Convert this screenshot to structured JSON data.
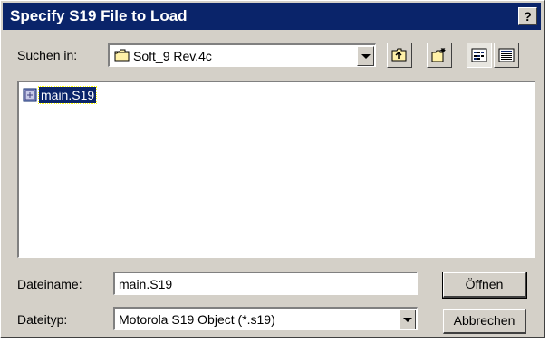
{
  "dialog": {
    "title": "Specify S19 File to Load",
    "help_label": "?"
  },
  "look_in": {
    "label": "Suchen in:",
    "value": "Soft_9 Rev.4c",
    "icon": "folder-icon"
  },
  "toolbar": {
    "buttons": [
      {
        "icon": "up-folder-icon"
      },
      {
        "icon": "new-folder-icon"
      },
      {
        "icon": "list-view-icon",
        "pressed": true
      },
      {
        "icon": "details-view-icon"
      }
    ]
  },
  "files": [
    {
      "name": "main.S19",
      "selected": true,
      "icon": "s19-file-icon"
    }
  ],
  "filename": {
    "label": "Dateiname:",
    "value": "main.S19"
  },
  "filetype": {
    "label": "Dateityp:",
    "value": "Motorola S19 Object (*.s19)"
  },
  "buttons": {
    "open_label": "Öffnen",
    "cancel_label": "Abbrechen"
  },
  "colors": {
    "titlebar": "#0a246a",
    "face": "#d4d0c8",
    "selection": "#0a246a"
  }
}
